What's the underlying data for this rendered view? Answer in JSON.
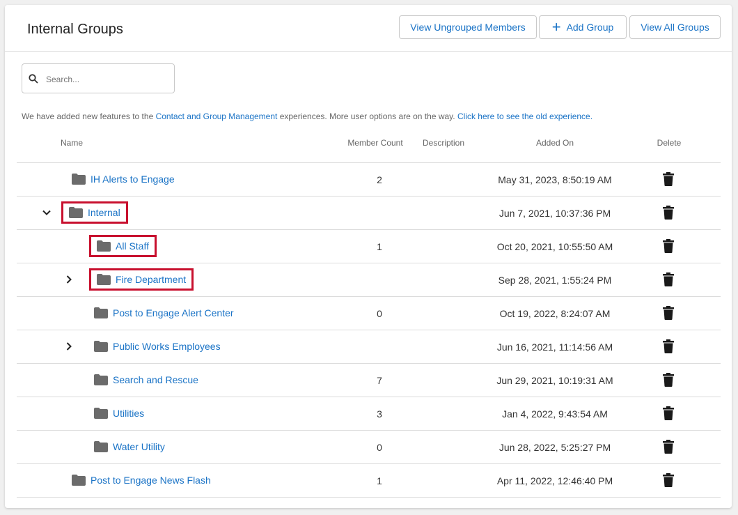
{
  "header": {
    "title": "Internal Groups",
    "buttons": {
      "ungrouped": "View Ungrouped Members",
      "add": "Add Group",
      "all": "View All Groups"
    }
  },
  "search": {
    "placeholder": "Search..."
  },
  "notice": {
    "prefix": "We have added new features to the ",
    "link1": "Contact and Group Management",
    "middle": " experiences. More user options are on the way. ",
    "link2": "Click here to see the old experience."
  },
  "table": {
    "columns": [
      "Name",
      "Member Count",
      "Description",
      "Added On",
      "Delete"
    ],
    "rows": [
      {
        "name": "IH Alerts to Engage",
        "count": "2",
        "added": "May 31, 2023, 8:50:19 AM",
        "chevron": "",
        "highlight": false,
        "depth": 0
      },
      {
        "name": "Internal",
        "count": "",
        "added": "Jun 7, 2021, 10:37:36 PM",
        "chevron": "expanded",
        "highlight": true,
        "depth": 0
      },
      {
        "name": "All Staff",
        "count": "1",
        "added": "Oct 20, 2021, 10:55:50 AM",
        "chevron": "",
        "highlight": true,
        "depth": 1
      },
      {
        "name": "Fire Department",
        "count": "",
        "added": "Sep 28, 2021, 1:55:24 PM",
        "chevron": "collapsed",
        "highlight": true,
        "depth": 1
      },
      {
        "name": "Post to Engage Alert Center",
        "count": "0",
        "added": "Oct 19, 2022, 8:24:07 AM",
        "chevron": "",
        "highlight": false,
        "depth": 1
      },
      {
        "name": "Public Works Employees",
        "count": "",
        "added": "Jun 16, 2021, 11:14:56 AM",
        "chevron": "collapsed",
        "highlight": false,
        "depth": 1
      },
      {
        "name": "Search and Rescue",
        "count": "7",
        "added": "Jun 29, 2021, 10:19:31 AM",
        "chevron": "",
        "highlight": false,
        "depth": 1
      },
      {
        "name": "Utilities",
        "count": "3",
        "added": "Jan 4, 2022, 9:43:54 AM",
        "chevron": "",
        "highlight": false,
        "depth": 1
      },
      {
        "name": "Water Utility",
        "count": "0",
        "added": "Jun 28, 2022, 5:25:27 PM",
        "chevron": "",
        "highlight": false,
        "depth": 1
      },
      {
        "name": "Post to Engage News Flash",
        "count": "1",
        "added": "Apr 11, 2022, 12:46:40 PM",
        "chevron": "",
        "highlight": false,
        "depth": 0
      }
    ]
  },
  "colors": {
    "link": "#1a73c6",
    "highlight": "#c8102e",
    "folder": "#6b6b6b",
    "trash": "#1a1a1a"
  },
  "icons": {
    "folder": "folder-icon",
    "trash": "trash-icon",
    "search": "search-icon",
    "plus": "plus-icon",
    "chevron_down": "chevron-down-icon",
    "chevron_right": "chevron-right-icon"
  }
}
